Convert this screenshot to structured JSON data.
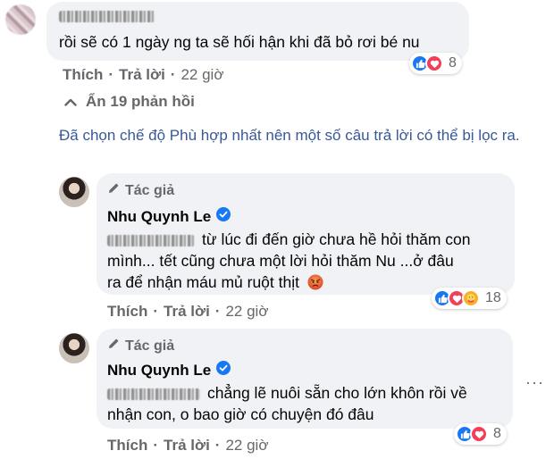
{
  "comment1": {
    "author_blurred": true,
    "text": "rồi sẽ có 1 ngày ng ta sẽ hối hận khi đã bỏ rơi bé nu",
    "like_label": "Thích",
    "reply_label": "Trả lời",
    "time": "22 giờ",
    "reaction_count": "8",
    "reactions": [
      "like-icon",
      "love-icon"
    ]
  },
  "hidden_replies": {
    "label": "Ẩn 19 phản hồi",
    "icon": "chevron-up-icon"
  },
  "filter_note": "Đã chọn chế độ Phù hợp nhất nên một số câu trả lời có thể bị lọc ra.",
  "reply1": {
    "tag": "Tác giả",
    "author": "Nhu Quynh Le",
    "text_line1": "từ lúc đi đến giờ chưa hề hỏi thăm con",
    "text_line2": "mình... tết cũng chưa một lời hỏi thăm Nu ...ở đâu",
    "text_line3": "ra để nhận máu mủ ruột thịt",
    "like_label": "Thích",
    "reply_label": "Trả lời",
    "time": "22 giờ",
    "reaction_count": "18",
    "reactions": [
      "like-icon",
      "love-icon",
      "care-icon"
    ]
  },
  "reply2": {
    "tag": "Tác giả",
    "author": "Nhu Quynh Le",
    "text_line1": "chẳng lẽ nuôi sẵn cho lớn khôn rồi về",
    "text_line2": "nhận con, o bao giờ có chuyện đó đâu",
    "like_label": "Thích",
    "reply_label": "Trả lời",
    "time": "22 giờ",
    "reaction_count": "8",
    "reactions": [
      "like-icon",
      "love-icon"
    ]
  },
  "colors": {
    "like": "#1877f2",
    "love": "#f33e58",
    "care": "#f7b125",
    "verified": "#1877f2",
    "meta_text": "#65676b",
    "link": "#385898",
    "bubble": "#f0f2f5"
  }
}
